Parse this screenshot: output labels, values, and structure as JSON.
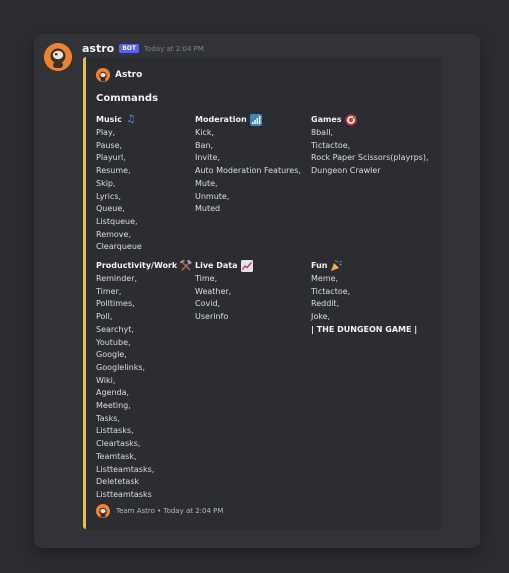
{
  "message": {
    "username": "astro",
    "bot_badge": "BOT",
    "timestamp": "Today at 2:04 PM"
  },
  "embed": {
    "accent_color": "#f0c419",
    "author_name": "Astro",
    "title": "Commands",
    "fields": [
      {
        "name": "Music",
        "emoji": "musical-note",
        "lines": [
          "Play,",
          "Pause,",
          "Playurl,",
          "Resume,",
          "Skip,",
          "Lyrics,",
          "Queue,",
          "Listqueue,",
          "Remove,",
          "Clearqueue"
        ]
      },
      {
        "name": "Moderation",
        "emoji": "signal-bars",
        "lines": [
          "Kick,",
          "Ban,",
          "Invite,",
          "Auto Moderation Features,",
          "Mute,",
          "Unmute,",
          "Muted"
        ]
      },
      {
        "name": "Games",
        "emoji": "target",
        "lines": [
          "8ball,",
          "Tictactoe,",
          "Rock Paper Scissors(playrps),",
          "Dungeon Crawler"
        ]
      },
      {
        "name": "Productivity/Work",
        "emoji": "hammer-pick",
        "lines": [
          "Reminder,",
          "Timer,",
          "Polltimes,",
          "Poll,",
          "Searchyt,",
          "Youtube,",
          "Google,",
          "Googlelinks,",
          "Wiki,",
          "Agenda,",
          "Meeting,",
          "Tasks,",
          "Listtasks,",
          "Cleartasks,",
          "Teamtask,",
          "Listteamtasks,",
          "Deletetask",
          "Listteamtasks"
        ]
      },
      {
        "name": "Live Data",
        "emoji": "chart-increasing",
        "lines": [
          "Time,",
          "Weather,",
          "Covid,",
          "Userinfo"
        ]
      },
      {
        "name": "Fun",
        "emoji": "party-popper",
        "lines": [
          "Meme,",
          "Tictactoe,",
          "Reddit,",
          "Joke,",
          "| THE DUNGEON GAME |"
        ]
      }
    ],
    "footer": {
      "text": "Team Astro • Today at 2:04 PM"
    }
  }
}
